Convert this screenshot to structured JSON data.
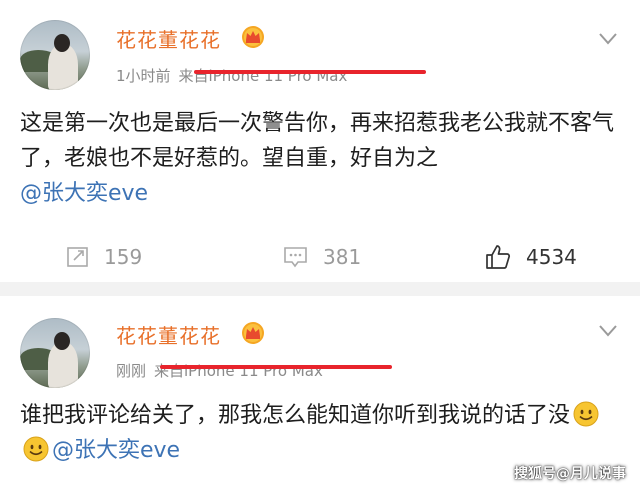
{
  "posts": [
    {
      "username": "花花董花花",
      "time": "1小时前",
      "source": "来自iPhone 11 Pro Max",
      "text_before": "这是第一次也是最后一次警告你，再来招惹我老公我就不客气了，老娘也不是好惹的。望自重，好自为之",
      "mention": "@张大奕eve",
      "repost_count": "159",
      "comment_count": "381",
      "like_count": "4534"
    },
    {
      "username": "花花董花花",
      "time": "刚刚",
      "source": "来自iPhone 11 Pro Max",
      "text_before": "谁把我评论给关了，那我怎么能知道你听到我说的话了没",
      "mention": "@张大奕eve"
    }
  ],
  "watermark": "搜狐号@月儿说事",
  "colors": {
    "username": "#e8702a",
    "mention": "#3d73b5",
    "strike": "#e8242c"
  },
  "icons": [
    "crown-vip-icon",
    "chevron-down-icon",
    "repost-icon",
    "comment-icon",
    "like-icon",
    "smile-emoji-icon"
  ]
}
